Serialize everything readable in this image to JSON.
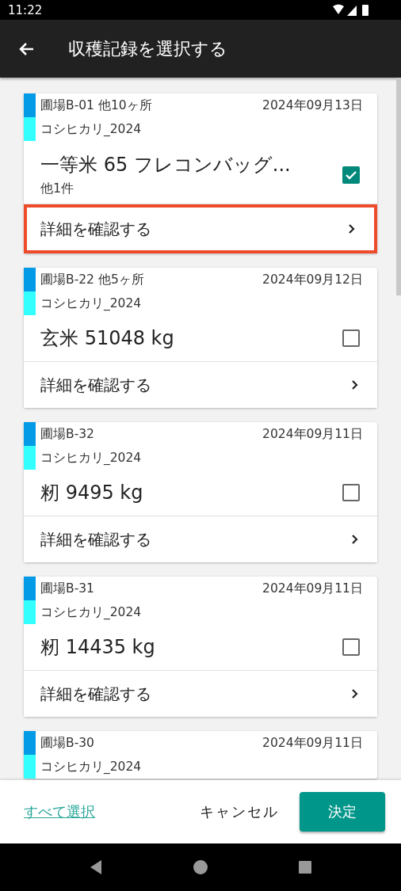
{
  "status_bar": {
    "time": "11:22"
  },
  "app_bar": {
    "title": "収穫記録を選択する"
  },
  "records": [
    {
      "field": "圃場B-01 他10ヶ所",
      "date": "2024年09月13日",
      "variety": "コシヒカリ_2024",
      "product": "一等米 65 フレコンバッグ...",
      "extra": "他1件",
      "checked": true,
      "detail": "詳細を確認する",
      "highlighted": true
    },
    {
      "field": "圃場B-22 他5ヶ所",
      "date": "2024年09月12日",
      "variety": "コシヒカリ_2024",
      "product": "玄米 51048 kg",
      "checked": false,
      "detail": "詳細を確認する",
      "highlighted": false
    },
    {
      "field": "圃場B-32",
      "date": "2024年09月11日",
      "variety": "コシヒカリ_2024",
      "product": "籾 9495 kg",
      "checked": false,
      "detail": "詳細を確認する",
      "highlighted": false
    },
    {
      "field": "圃場B-31",
      "date": "2024年09月11日",
      "variety": "コシヒカリ_2024",
      "product": "籾 14435 kg",
      "checked": false,
      "detail": "詳細を確認する",
      "highlighted": false
    },
    {
      "field": "圃場B-30",
      "date": "2024年09月11日",
      "variety": "コシヒカリ_2024"
    }
  ],
  "footer": {
    "select_all": "すべて選択",
    "cancel": "キャンセル",
    "confirm": "決定"
  }
}
